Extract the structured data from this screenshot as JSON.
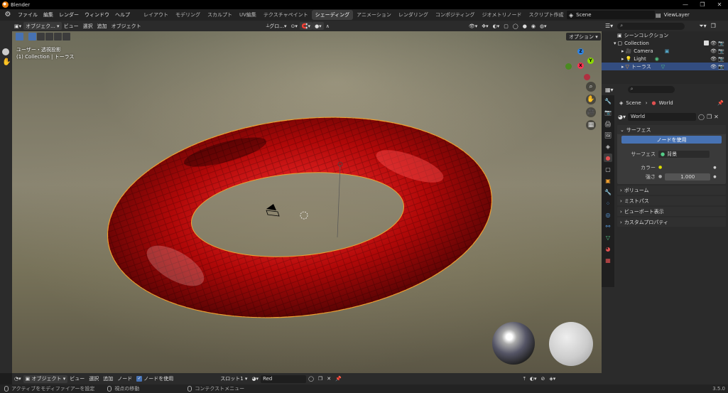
{
  "window": {
    "title": "Blender",
    "controls": [
      "—",
      "❐",
      "✕"
    ]
  },
  "menu": {
    "items": [
      "ファイル",
      "編集",
      "レンダー",
      "ウィンドウ",
      "ヘルプ"
    ],
    "workspaces": [
      "レイアウト",
      "モデリング",
      "スカルプト",
      "UV編集",
      "テクスチャペイント",
      "シェーディング",
      "アニメーション",
      "レンダリング",
      "コンポジティング",
      "ジオメトリノード",
      "スクリプト作成"
    ],
    "active_workspace_index": 5,
    "add_tab": "+",
    "scene": "Scene",
    "view_layer": "ViewLayer"
  },
  "viewport": {
    "header": {
      "mode": "オブジェク...",
      "menus": [
        "ビュー",
        "選択",
        "追加",
        "オブジェクト"
      ],
      "transform": "グロ..."
    },
    "options": "オプション",
    "info_line1": "ユーザー・透視投影",
    "info_line2": "(1) Collection | トーラス",
    "gizmo": {
      "z": "Z",
      "y": "Y",
      "x": "X"
    }
  },
  "bottombar": {
    "mode": "オブジェクト",
    "menus": [
      "ビュー",
      "選択",
      "追加",
      "ノード"
    ],
    "use_nodes": "ノードを使用",
    "slot": "スロット1",
    "material": "Red"
  },
  "statusbar": {
    "items": [
      "アクティブをモディファイアーを設定",
      "視点の移動",
      "コンテクストメニュー"
    ],
    "version": "3.5.0"
  },
  "outliner": {
    "root": "シーンコレクション",
    "rows": [
      {
        "label": "Collection",
        "selected": false
      },
      {
        "label": "Camera",
        "selected": false
      },
      {
        "label": "Light",
        "selected": false
      },
      {
        "label": "トーラス",
        "selected": true
      }
    ]
  },
  "properties": {
    "breadcrumb_scene": "Scene",
    "breadcrumb_world": "World",
    "world_name": "World",
    "surface_panel": "サーフェス",
    "use_nodes_btn": "ノードを使用",
    "surface_label": "サーフェス",
    "surface_value": "背景",
    "color_label": "カラー",
    "strength_label": "強さ",
    "strength_value": "1.000",
    "panels": [
      "ボリューム",
      "ミストパス",
      "ビューポート表示",
      "カスタムプロパティ"
    ]
  },
  "colors": {
    "accent": "#4772b3",
    "selection": "#334d80",
    "torus": "#c81010",
    "outline": "#f0a030"
  }
}
